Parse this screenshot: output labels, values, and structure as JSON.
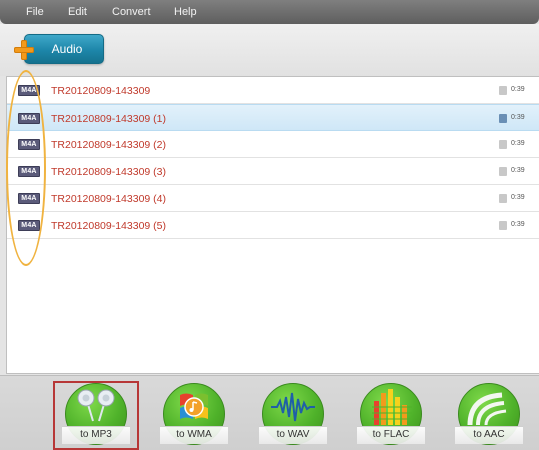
{
  "menubar": {
    "items": [
      "File",
      "Edit",
      "Convert",
      "Help"
    ]
  },
  "toolbar": {
    "add_audio_label": "Audio"
  },
  "files": [
    {
      "badge": "M4A",
      "name": "TR20120809-143309",
      "duration": "0:39",
      "selected": false
    },
    {
      "badge": "M4A",
      "name": "TR20120809-143309 (1)",
      "duration": "0:39",
      "selected": true
    },
    {
      "badge": "M4A",
      "name": "TR20120809-143309 (2)",
      "duration": "0:39",
      "selected": false
    },
    {
      "badge": "M4A",
      "name": "TR20120809-143309 (3)",
      "duration": "0:39",
      "selected": false
    },
    {
      "badge": "M4A",
      "name": "TR20120809-143309 (4)",
      "duration": "0:39",
      "selected": false
    },
    {
      "badge": "M4A",
      "name": "TR20120809-143309 (5)",
      "duration": "0:39",
      "selected": false
    }
  ],
  "convert": {
    "mp3": "to MP3",
    "wma": "to WMA",
    "wav": "to WAV",
    "flac": "to FLAC",
    "aac": "to AAC"
  },
  "colors": {
    "file_name": "#c0392b",
    "accent_button": "#1d86a9",
    "convert_green": "#4fb22a",
    "annotation_orange": "#f0b340",
    "selection_red": "#b73737"
  }
}
